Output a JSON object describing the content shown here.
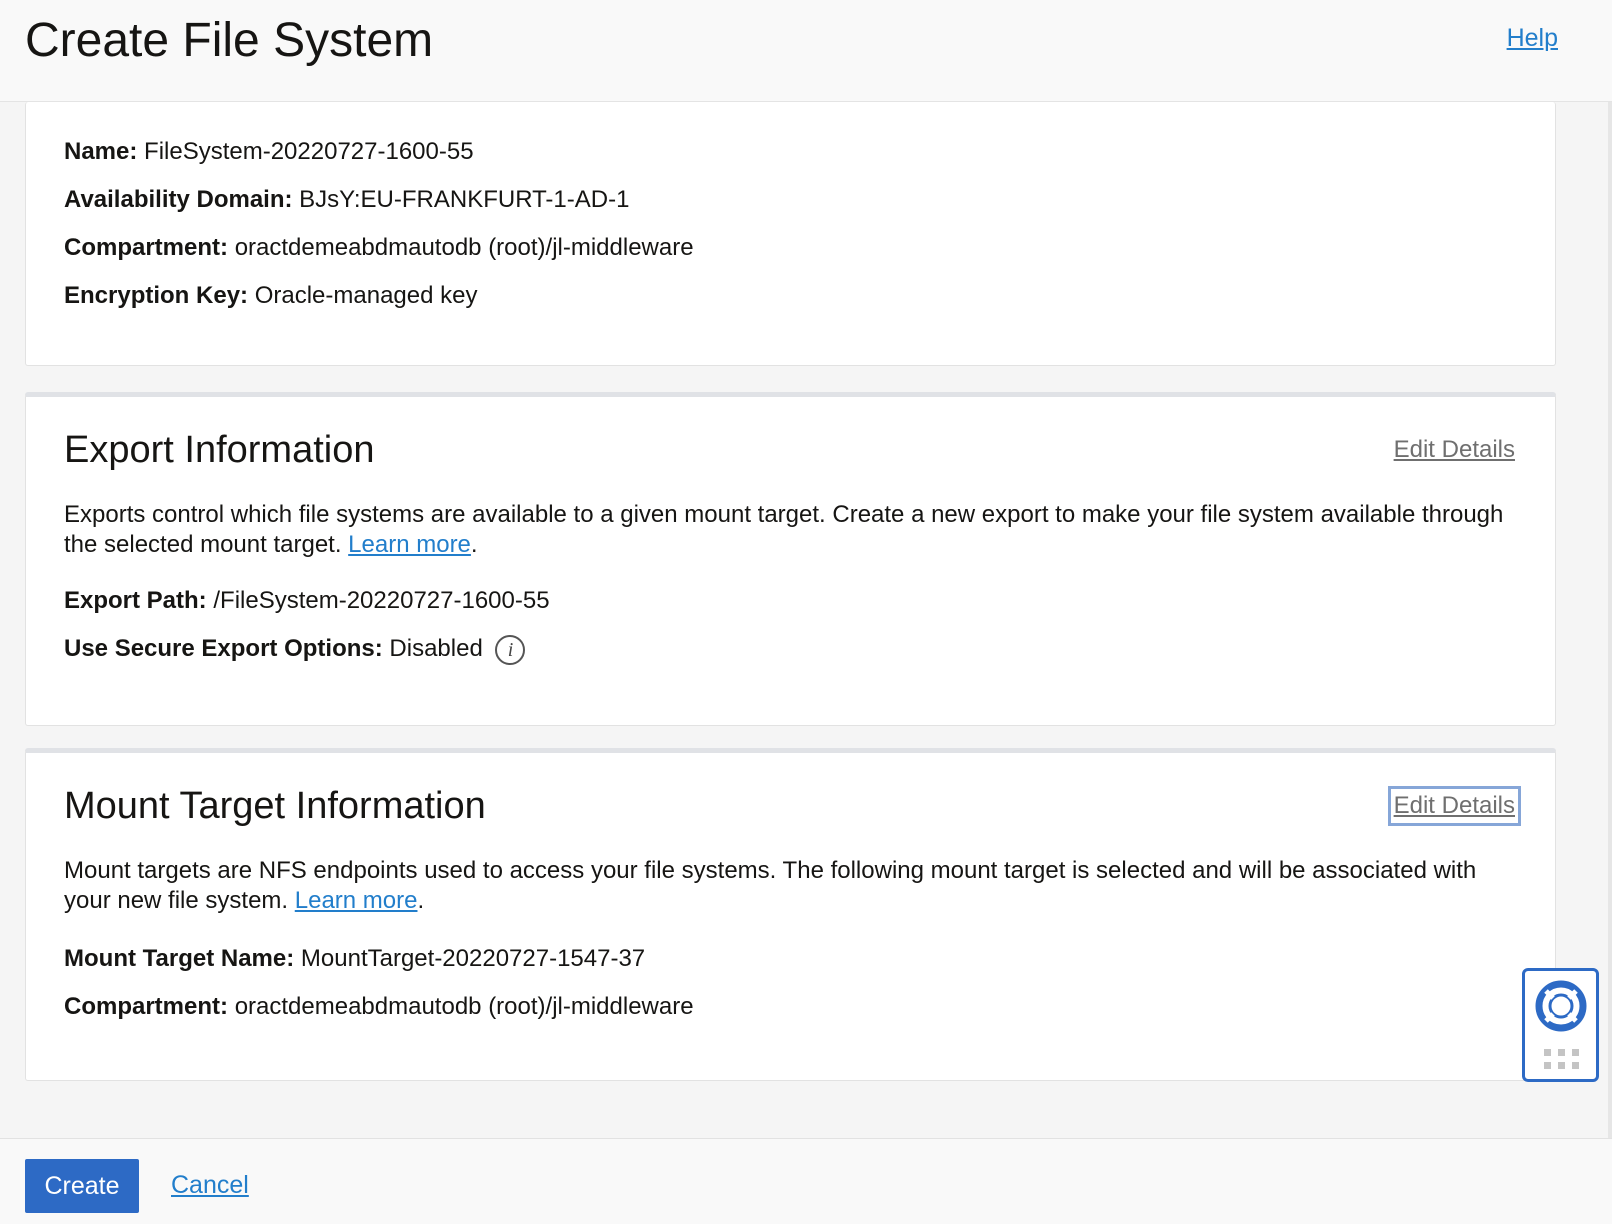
{
  "header": {
    "title": "Create File System",
    "help_label": "Help"
  },
  "summary": {
    "rows": [
      {
        "label": "Name:",
        "value": "FileSystem-20220727-1600-55"
      },
      {
        "label": "Availability Domain:",
        "value": "BJsY:EU-FRANKFURT-1-AD-1"
      },
      {
        "label": "Compartment:",
        "value": "oractdemeabdmautodb (root)/jl-middleware"
      },
      {
        "label": "Encryption Key:",
        "value": "Oracle-managed key"
      }
    ]
  },
  "export": {
    "title": "Export Information",
    "edit_label": "Edit Details",
    "description": "Exports control which file systems are available to a given mount target. Create a new export to make your file system available through the selected mount target.",
    "learn_more": "Learn more",
    "after_link": ".",
    "path_label": "Export Path:",
    "path_value": "/FileSystem-20220727-1600-55",
    "secure_label": "Use Secure Export Options:",
    "secure_value": "Disabled",
    "info_glyph": "i"
  },
  "mount": {
    "title": "Mount Target Information",
    "edit_label": "Edit Details",
    "description": "Mount targets are NFS endpoints used to access your file systems. The following mount target is selected and will be associated with your new file system.",
    "learn_more": "Learn more",
    "after_link": ".",
    "name_label": "Mount Target Name:",
    "name_value": "MountTarget-20220727-1547-37",
    "compartment_label": "Compartment:",
    "compartment_value": "oractdemeabdmautodb (root)/jl-middleware"
  },
  "footer": {
    "create_label": "Create",
    "cancel_label": "Cancel"
  },
  "colors": {
    "primary": "#2d6ac5",
    "link": "#227ecb"
  },
  "icons": {
    "info": "info-icon",
    "help_widget": "lifebuoy-icon",
    "grip": "grip-dots-icon"
  }
}
